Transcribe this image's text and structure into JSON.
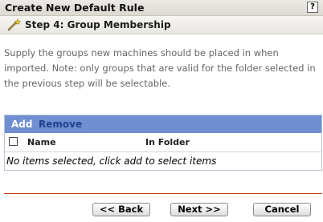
{
  "dialog": {
    "title": "Create New Default Rule",
    "help_label": "?"
  },
  "step": {
    "label": "Step 4: Group Membership",
    "icon": "wand-icon"
  },
  "instructions": "Supply the groups new machines should be placed in when imported. Note: only groups that are valid for the folder selected in the previous step will be selectable.",
  "table": {
    "toolbar": {
      "add_label": "Add",
      "remove_label": "Remove"
    },
    "columns": [
      "Name",
      "In Folder"
    ],
    "empty_message": "No items selected, click add to select items"
  },
  "buttons": {
    "back": "<< Back",
    "next": "Next >>",
    "cancel": "Cancel"
  },
  "colors": {
    "toolbar_bg": "#6f8fd2",
    "divider": "#c8401c",
    "remove_link": "#203f8f"
  }
}
